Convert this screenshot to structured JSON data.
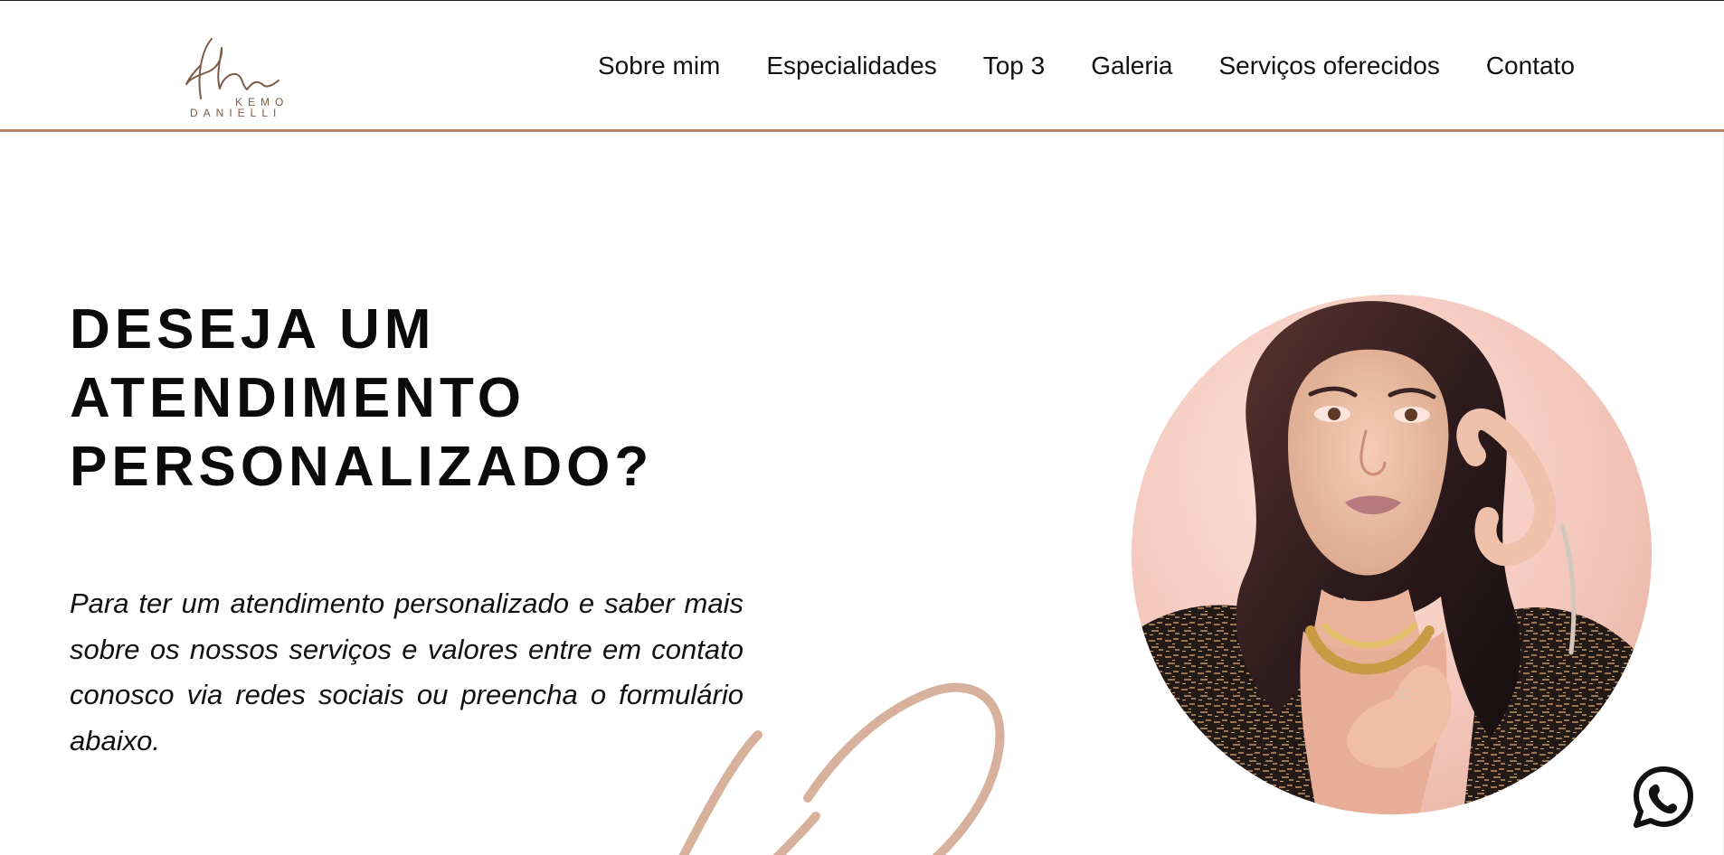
{
  "brand": {
    "logo_first": "KEMO",
    "logo_last": "DANIELLI"
  },
  "nav": {
    "items": [
      {
        "label": "Sobre mim"
      },
      {
        "label": "Especialidades"
      },
      {
        "label": "Top 3"
      },
      {
        "label": "Galeria"
      },
      {
        "label": "Serviços oferecidos"
      },
      {
        "label": "Contato"
      }
    ]
  },
  "hero": {
    "title_lines": [
      "DESEJA UM",
      "ATENDIMENTO",
      "PERSONALIZADO?"
    ],
    "intro": "Para ter um atendimento personalizado e saber mais sobre os nossos serviços e valores entre em contato conosco via redes sociais ou preencha o formulário abaixo."
  },
  "colors": {
    "accent": "#b5835f",
    "portrait_bg": "#f4c8bd",
    "text": "#111111",
    "signature": "#d7b19b"
  },
  "icons": {
    "whatsapp": "whatsapp-icon",
    "logo": "signature-logo"
  }
}
